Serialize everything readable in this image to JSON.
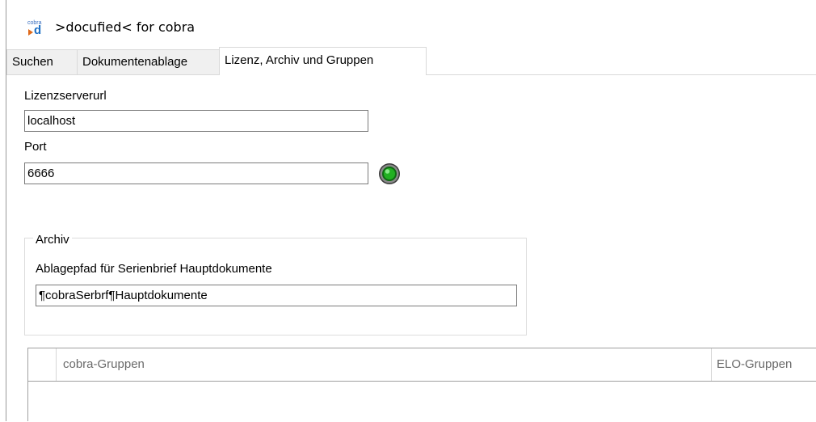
{
  "window": {
    "title": ">docufied< for cobra",
    "logo_small_text": "cobra",
    "logo_letter": "d"
  },
  "tabs": [
    {
      "label": "Suchen",
      "active": false
    },
    {
      "label": "Dokumentenablage",
      "active": false
    },
    {
      "label": "Lizenz, Archiv und Gruppen",
      "active": true
    }
  ],
  "license": {
    "server_url_label": "Lizenzserverurl",
    "server_url_value": "localhost",
    "port_label": "Port",
    "port_value": "6666",
    "status_icon": "green-status-led",
    "status_color": "#22b022"
  },
  "archive": {
    "group_label": "Archiv",
    "path_label": "Ablagepfad für Serienbrief Hauptdokumente",
    "path_value": "¶cobraSerbrf¶Hauptdokumente"
  },
  "groups_grid": {
    "columns": [
      "cobra-Gruppen",
      "ELO-Gruppen"
    ],
    "rows": []
  }
}
